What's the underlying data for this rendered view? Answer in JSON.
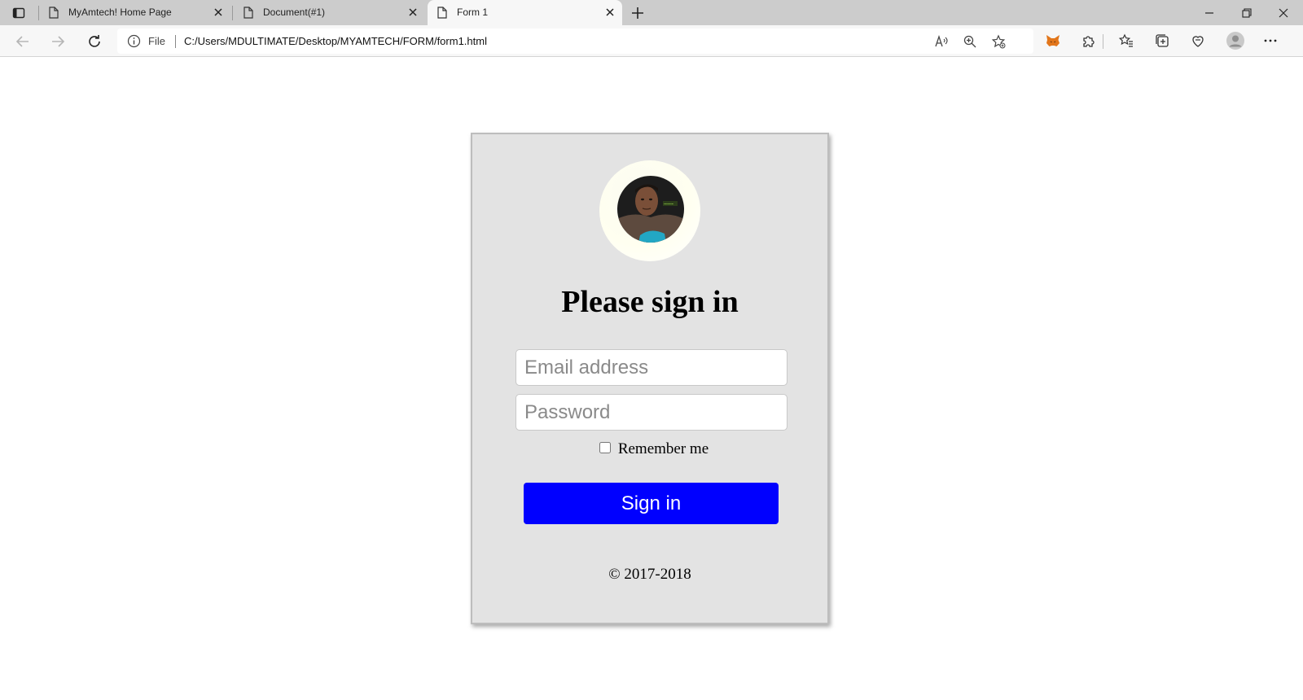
{
  "browser": {
    "tabs": [
      {
        "title": "MyAmtech! Home Page",
        "active": false
      },
      {
        "title": "Document(#1)",
        "active": false
      },
      {
        "title": "Form 1",
        "active": true
      }
    ],
    "address": {
      "scheme_label": "File",
      "url": "C:/Users/MDULTIMATE/Desktop/MYAMTECH/FORM/form1.html"
    }
  },
  "form": {
    "heading": "Please sign in",
    "email_placeholder": "Email address",
    "password_placeholder": "Password",
    "remember_label": "Remember me",
    "remember_checked": false,
    "submit_label": "Sign in",
    "footer": "© 2017-2018"
  },
  "colors": {
    "button": "#0000ff",
    "card_background": "#e3e3e3",
    "tabstrip": "#cccccc",
    "metamask_orange": "#e2761b"
  },
  "icons": {
    "tab_actions": "tab-actions-icon",
    "tab_doc": "document-icon",
    "close": "close-icon",
    "new_tab": "plus-icon",
    "back": "arrow-left-icon",
    "forward": "arrow-right-icon",
    "refresh": "refresh-icon",
    "info": "info-icon",
    "read_aloud": "read-aloud-icon",
    "zoom": "zoom-icon",
    "add_favorite": "star-add-icon",
    "metamask": "fox-icon",
    "extensions": "puzzle-icon",
    "favorites": "favorites-icon",
    "collections": "collections-icon",
    "browser_essentials": "heart-icon",
    "profile": "profile-icon",
    "more": "more-icon"
  }
}
